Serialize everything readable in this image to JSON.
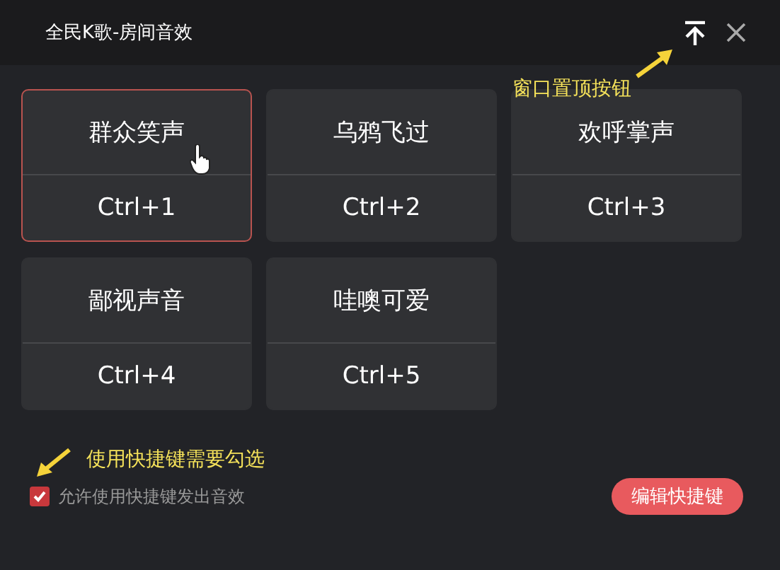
{
  "window": {
    "title": "全民K歌-房间音效"
  },
  "effects": [
    {
      "name": "群众笑声",
      "shortcut": "Ctrl+1",
      "selected": true
    },
    {
      "name": "乌鸦飞过",
      "shortcut": "Ctrl+2",
      "selected": false
    },
    {
      "name": "欢呼掌声",
      "shortcut": "Ctrl+3",
      "selected": false
    },
    {
      "name": "鄙视声音",
      "shortcut": "Ctrl+4",
      "selected": false
    },
    {
      "name": "哇噢可爱",
      "shortcut": "Ctrl+5",
      "selected": false
    }
  ],
  "shortcut_option": {
    "label": "允许使用快捷键发出音效",
    "checked": true
  },
  "edit_button": "编辑快捷键",
  "annotations": [
    "窗口置顶按钮",
    "使用快捷键需要勾选"
  ]
}
